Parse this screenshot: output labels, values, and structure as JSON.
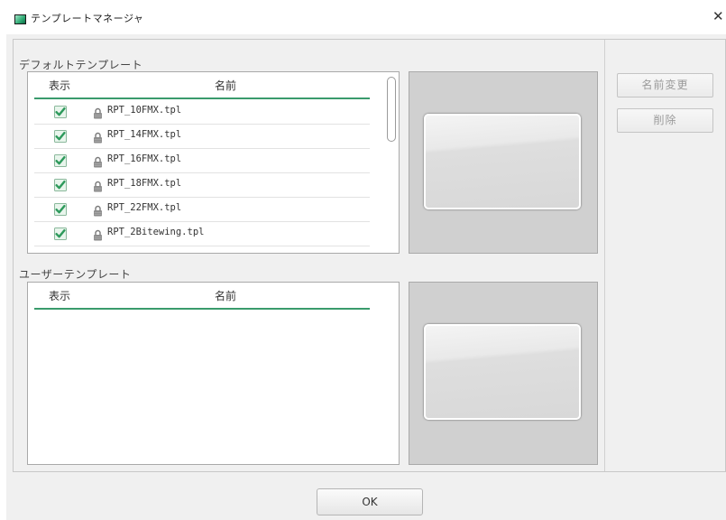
{
  "window": {
    "title": "テンプレートマネージャ",
    "close_glyph": "✕"
  },
  "default_templates": {
    "section_label": "デフォルトテンプレート",
    "columns": {
      "show": "表示",
      "name": "名前"
    },
    "rows": [
      {
        "checked": true,
        "locked": true,
        "name": "RPT_10FMX.tpl"
      },
      {
        "checked": true,
        "locked": true,
        "name": "RPT_14FMX.tpl"
      },
      {
        "checked": true,
        "locked": true,
        "name": "RPT_16FMX.tpl"
      },
      {
        "checked": true,
        "locked": true,
        "name": "RPT_18FMX.tpl"
      },
      {
        "checked": true,
        "locked": true,
        "name": "RPT_22FMX.tpl"
      },
      {
        "checked": true,
        "locked": true,
        "name": "RPT_2Bitewing.tpl"
      }
    ]
  },
  "user_templates": {
    "section_label": "ユーザーテンプレート",
    "columns": {
      "show": "表示",
      "name": "名前"
    },
    "rows": []
  },
  "actions": {
    "rename_label": "名前変更",
    "delete_label": "削除",
    "ok_label": "OK"
  },
  "colors": {
    "accent": "#3a9b6c",
    "check": "#2e9a5c",
    "preview_bg": "#d0d0d0"
  }
}
